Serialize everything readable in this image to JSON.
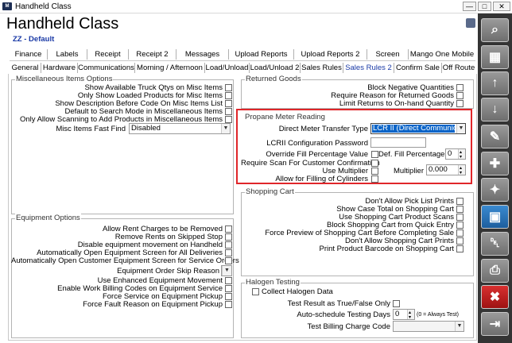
{
  "window": {
    "title": "Handheld Class",
    "controls": [
      "—",
      "□",
      "✕"
    ]
  },
  "header": {
    "title": "Handheld Class",
    "subtitle": "ZZ - Default"
  },
  "tabs_row1": [
    "Finance",
    "Labels",
    "Receipt",
    "Receipt 2",
    "Messages",
    "Upload Reports",
    "Upload Reports 2",
    "Screen",
    "Mango One Mobile"
  ],
  "tabs_row2": [
    "General",
    "Hardware",
    "Communications",
    "Morning / Afternoon",
    "Load/Unload",
    "Load/Unload 2",
    "Sales Rules",
    "Sales Rules 2",
    "Confirm Sale",
    "Off Route"
  ],
  "active_tab": "Sales Rules 2",
  "misc_items": {
    "title": "Miscellaneous Items Options",
    "checks": [
      {
        "label": "Show Available Truck Qtys on Misc Items",
        "checked": false
      },
      {
        "label": "Only Show Loaded Products for Misc Items",
        "checked": false
      },
      {
        "label": "Show Description Before Code On Misc Items List",
        "checked": false
      },
      {
        "label": "Default to Search Mode in Miscellaneous Items",
        "checked": false
      },
      {
        "label": "Only Allow Scanning to Add Products in Miscellaneous Items",
        "checked": false
      }
    ],
    "fast_find_label": "Misc Items Fast Find",
    "fast_find_value": "Disabled"
  },
  "equipment": {
    "title": "Equipment Options",
    "checks_a": [
      {
        "label": "Allow Rent Charges to be Removed",
        "checked": false
      },
      {
        "label": "Remove Rents on Skipped Stop",
        "checked": false
      },
      {
        "label": "Disable equipment movement on Handheld",
        "checked": false
      },
      {
        "label": "Automatically Open Equipment Screen for All Deliveries",
        "checked": false
      },
      {
        "label": "Automatically Open Customer Equipment Screen for Service Orders",
        "checked": false
      }
    ],
    "skip_reason_label": "Equipment Order Skip Reason",
    "skip_reason_value": "",
    "checks_b": [
      {
        "label": "Use Enhanced Equipment Movement",
        "checked": false
      },
      {
        "label": "Enable Work Billing Codes on Equipment Service",
        "checked": false
      },
      {
        "label": "Force Service on Equipment Pickup",
        "checked": false
      },
      {
        "label": "Force Fault Reason on Equipment Pickup",
        "checked": false
      }
    ]
  },
  "returned_goods": {
    "title": "Returned Goods",
    "checks": [
      {
        "label": "Block Negative Quantities",
        "checked": false
      },
      {
        "label": "Require Reason for Returned Goods",
        "checked": false
      },
      {
        "label": "Limit Returns to On-hand Quantity",
        "checked": false
      }
    ]
  },
  "propane": {
    "title": "Propane Meter Reading",
    "transfer_type_label": "Direct Meter Transfer Type",
    "transfer_type_value": "LCR II (Direct Communicatio",
    "config_pw_label": "LCRII Configuration Password",
    "config_pw_value": "",
    "override_label": "Override Fill Percentage Value",
    "def_fill_label": "Def. Fill Percentage",
    "def_fill_value": "0",
    "require_scan_label": "Require Scan For Customer Confirmation",
    "use_multiplier_label": "Use Multiplier",
    "multiplier_label": "Multiplier",
    "multiplier_value": "0.000",
    "allow_cylinders_label": "Allow for Filling of Cylinders"
  },
  "shopping_cart": {
    "title": "Shopping Cart",
    "checks": [
      {
        "label": "Don't Allow Pick List Prints",
        "checked": false
      },
      {
        "label": "Show Case Total on Shopping Cart",
        "checked": false
      },
      {
        "label": "Use Shopping Cart Product Scans",
        "checked": false
      },
      {
        "label": "Block Shopping Cart from Quick Entry",
        "checked": false
      },
      {
        "label": "Force Preview of Shopping Cart Before Completing Sale",
        "checked": false
      },
      {
        "label": "Don't Allow Shopping Cart Prints",
        "checked": false
      },
      {
        "label": "Print Product Barcode on Shopping Cart",
        "checked": false
      }
    ]
  },
  "halogen": {
    "title": "Halogen Testing",
    "collect_label": "Collect Halogen Data",
    "true_false_label": "Test Result as True/False Only",
    "auto_days_label": "Auto-schedule Testing Days",
    "auto_days_value": "0",
    "auto_days_note": "(0 = Always Test)",
    "billing_label": "Test Billing Charge Code",
    "billing_value": ""
  },
  "toolbar": {
    "buttons": [
      {
        "icon": "search-icon",
        "glyph": "⌕"
      },
      {
        "icon": "grid-icon",
        "glyph": "▦"
      },
      {
        "icon": "arrow-up-icon",
        "glyph": "↑"
      },
      {
        "icon": "arrow-down-icon",
        "glyph": "↓"
      },
      {
        "icon": "pencil-icon",
        "glyph": "✎"
      },
      {
        "icon": "new-document-icon",
        "glyph": "✚"
      },
      {
        "icon": "new-item-icon",
        "glyph": "✦"
      },
      {
        "icon": "save-icon",
        "glyph": "▣"
      },
      {
        "icon": "trash-icon",
        "glyph": "␡"
      },
      {
        "icon": "print-icon",
        "glyph": "⎙"
      },
      {
        "icon": "cancel-icon",
        "glyph": "✖"
      },
      {
        "icon": "exit-icon",
        "glyph": "⇥"
      }
    ],
    "colors": {
      "default": "#808080",
      "save": "#2a72b8",
      "cancel": "#c01a1a"
    }
  }
}
